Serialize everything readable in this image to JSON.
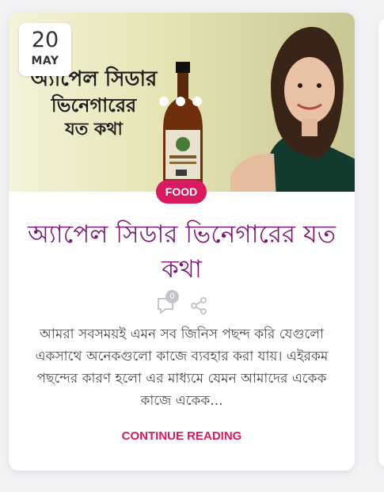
{
  "post": {
    "date_day": "20",
    "date_month": "MAY",
    "category": "FOOD",
    "title": "অ্যাপেল সিডার ভিনেগারের যত কথা",
    "comment_count": "0",
    "excerpt": "আমরা সবসময়ই এমন সব জিনিস পছন্দ করি যেগুলো একসাথে অনেকগুলো কাজে ব্যবহার করা যায়। এইরকম পছন্দের কারণ হলো এর মাধ্যমে যেমন আমাদের একেক কাজে একেক...",
    "continue_label": "CONTINUE READING"
  },
  "hero_image": {
    "line1": "অ্যাপেল সিডার",
    "line2": "ভিনেগারের",
    "line3": "যত কথা"
  },
  "colors": {
    "accent": "#d81b60",
    "title": "#7b1474",
    "text": "#4a4a4a",
    "background": "#f3f3f6"
  },
  "icons": {
    "comment": "comment-icon",
    "share": "share-icon",
    "gallery_dots": "more-dots-icon"
  }
}
